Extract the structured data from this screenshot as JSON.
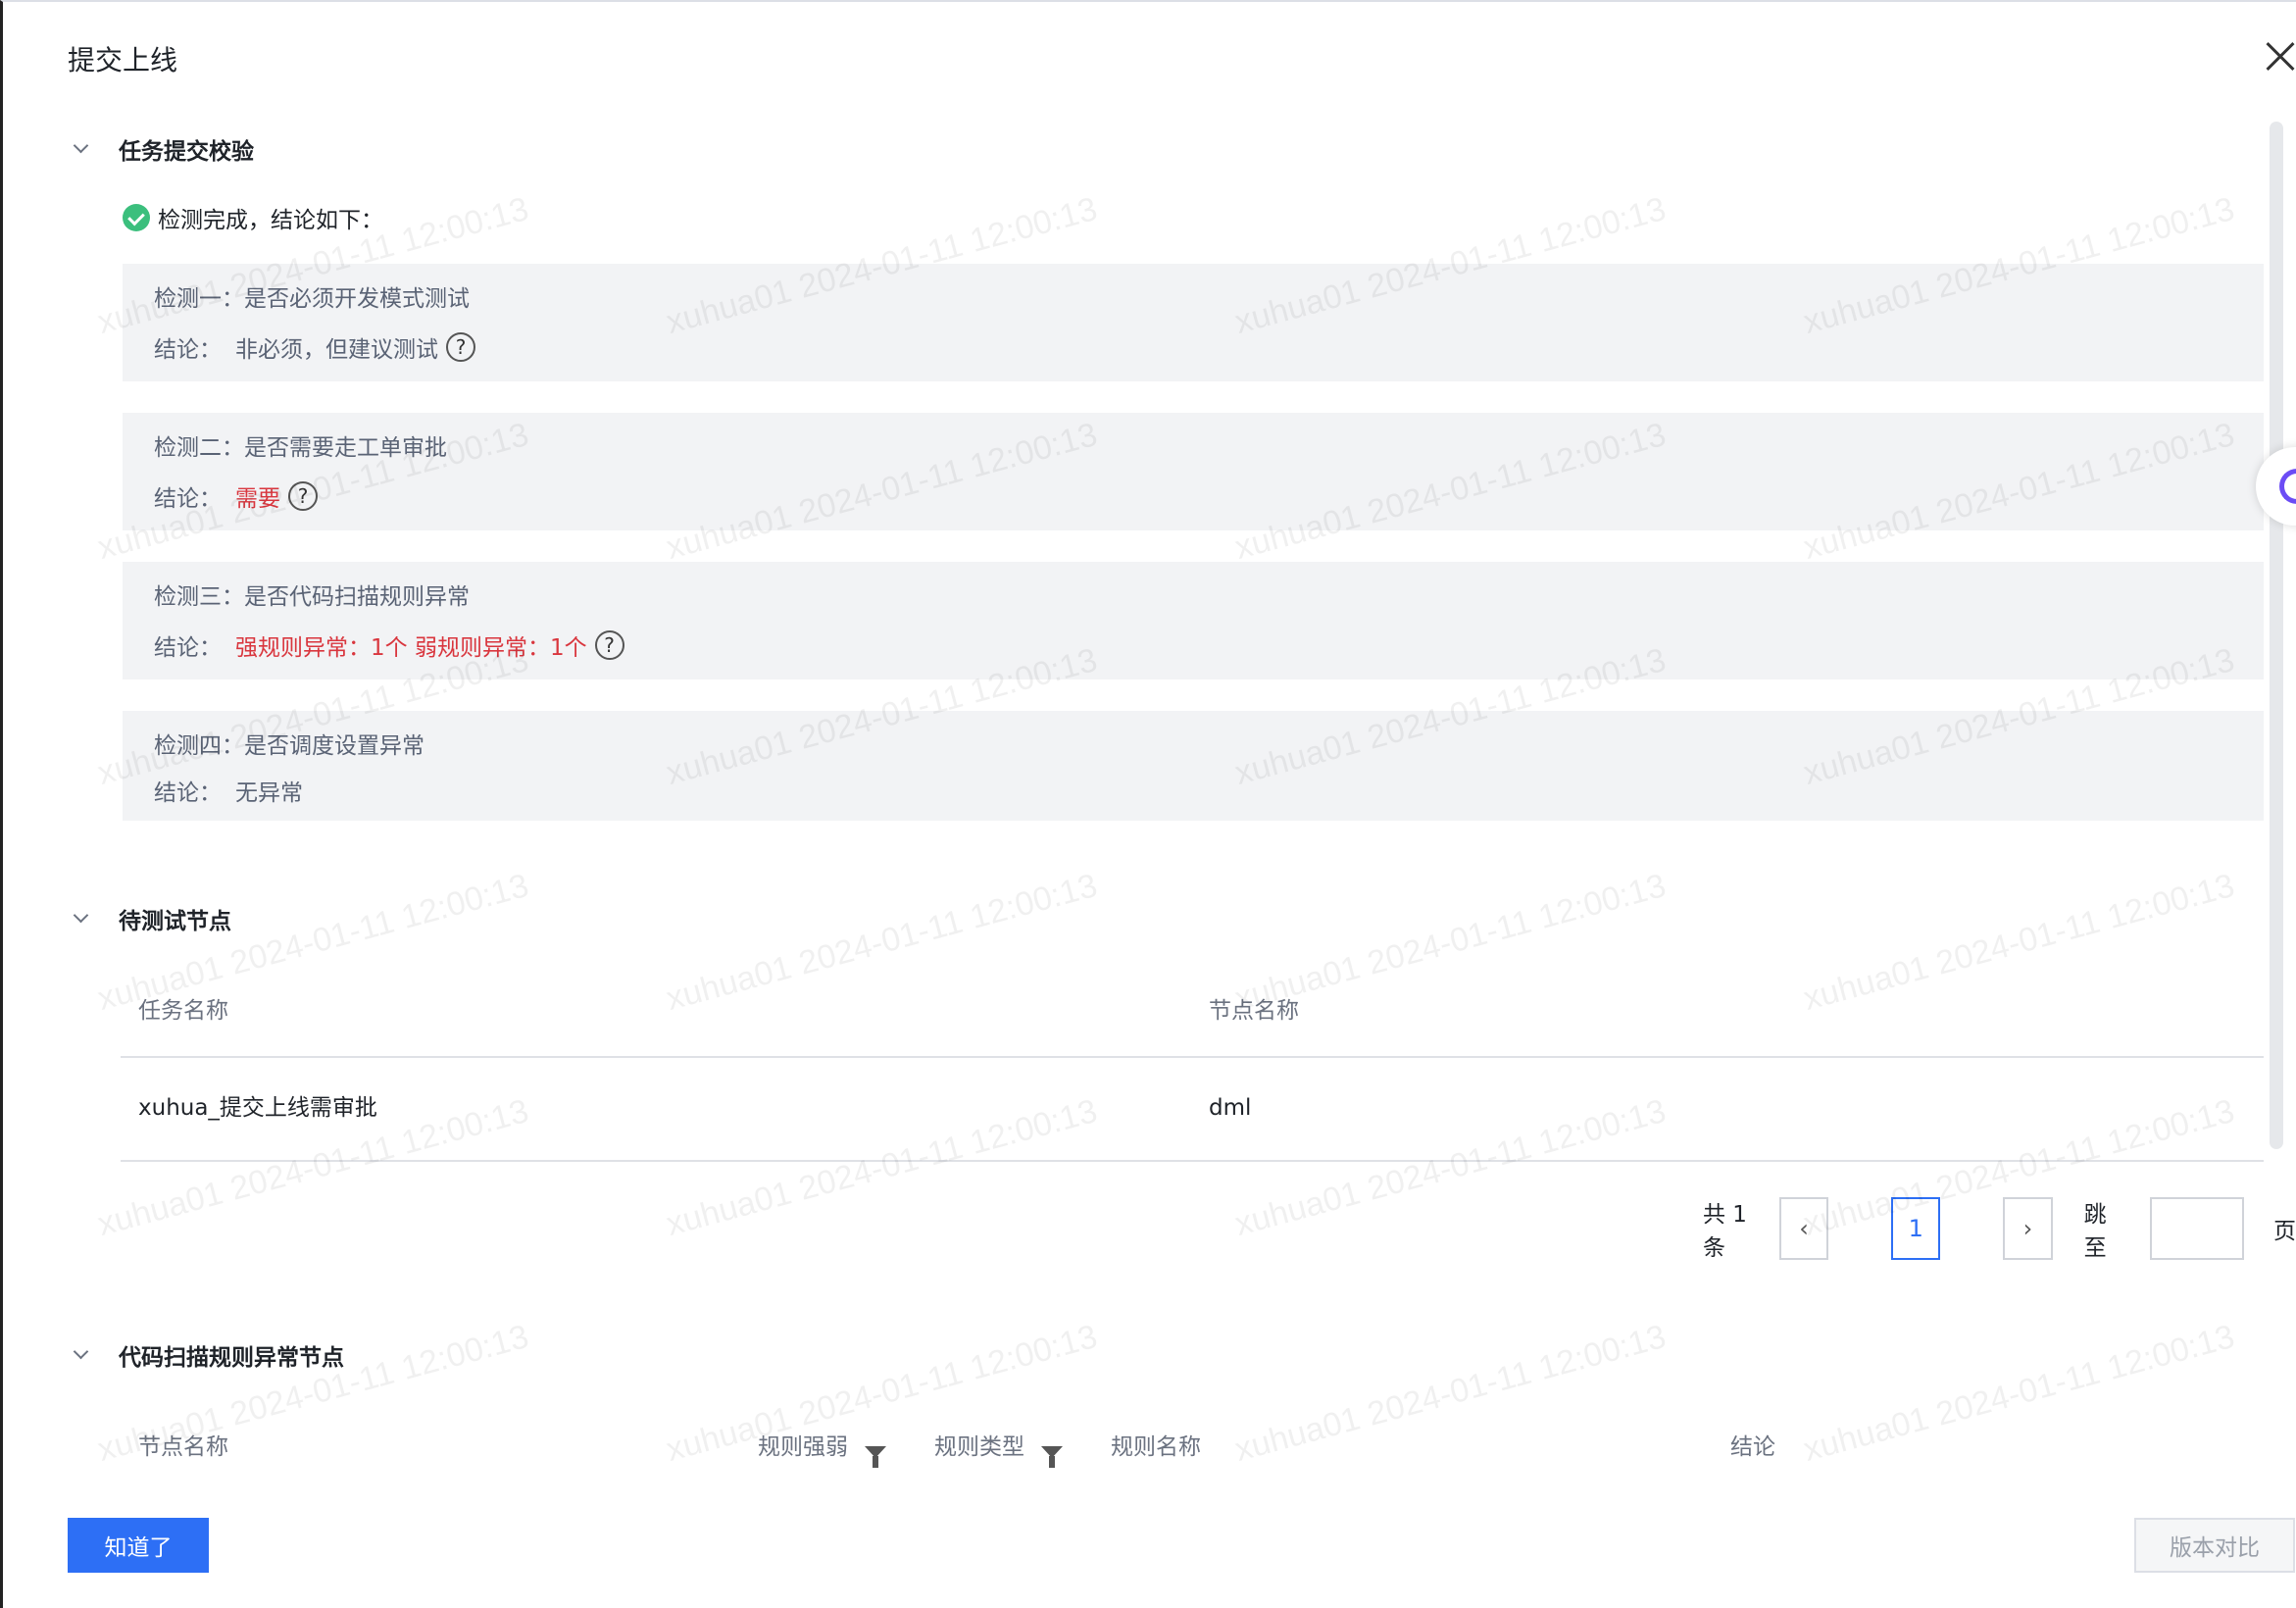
{
  "dialog": {
    "title": "提交上线"
  },
  "sections": {
    "validation": {
      "title": "任务提交校验",
      "status": "检测完成，结论如下：",
      "checks": [
        {
          "label": "检测一：是否必须开发模式测试",
          "result_label": "结论：",
          "result": "非必须，但建议测试",
          "highlight": false,
          "has_help": true
        },
        {
          "label": "检测二：是否需要走工单审批",
          "result_label": "结论：",
          "result": "需要",
          "highlight": true,
          "has_help": true
        },
        {
          "label": "检测三：是否代码扫描规则异常",
          "result_label": "结论：",
          "result": "强规则异常：1个 弱规则异常：1个",
          "highlight": true,
          "has_help": true
        },
        {
          "label": "检测四：是否调度设置异常",
          "result_label": "结论：",
          "result": "无异常",
          "highlight": false,
          "has_help": false
        }
      ]
    },
    "pending_nodes": {
      "title": "待测试节点",
      "columns": [
        "任务名称",
        "节点名称"
      ],
      "rows": [
        [
          "xuhua_提交上线需审批",
          "dml"
        ]
      ],
      "pagination": {
        "total": "共 1 条",
        "current_page": "1",
        "jump_label": "跳至",
        "jump_value": "",
        "page_suffix": "页"
      }
    },
    "scan_nodes": {
      "title": "代码扫描规则异常节点",
      "columns": [
        "节点名称",
        "规则强弱",
        "规则类型",
        "规则名称",
        "结论"
      ]
    }
  },
  "footer": {
    "confirm_label": "知道了",
    "compare_label": "版本对比"
  },
  "watermark": "xuhua01 2024-01-11 12:00:13",
  "colors": {
    "primary": "#2d6ff5",
    "danger": "#d9363e",
    "success": "#3bbf7d",
    "card_bg": "#f2f3f5"
  }
}
